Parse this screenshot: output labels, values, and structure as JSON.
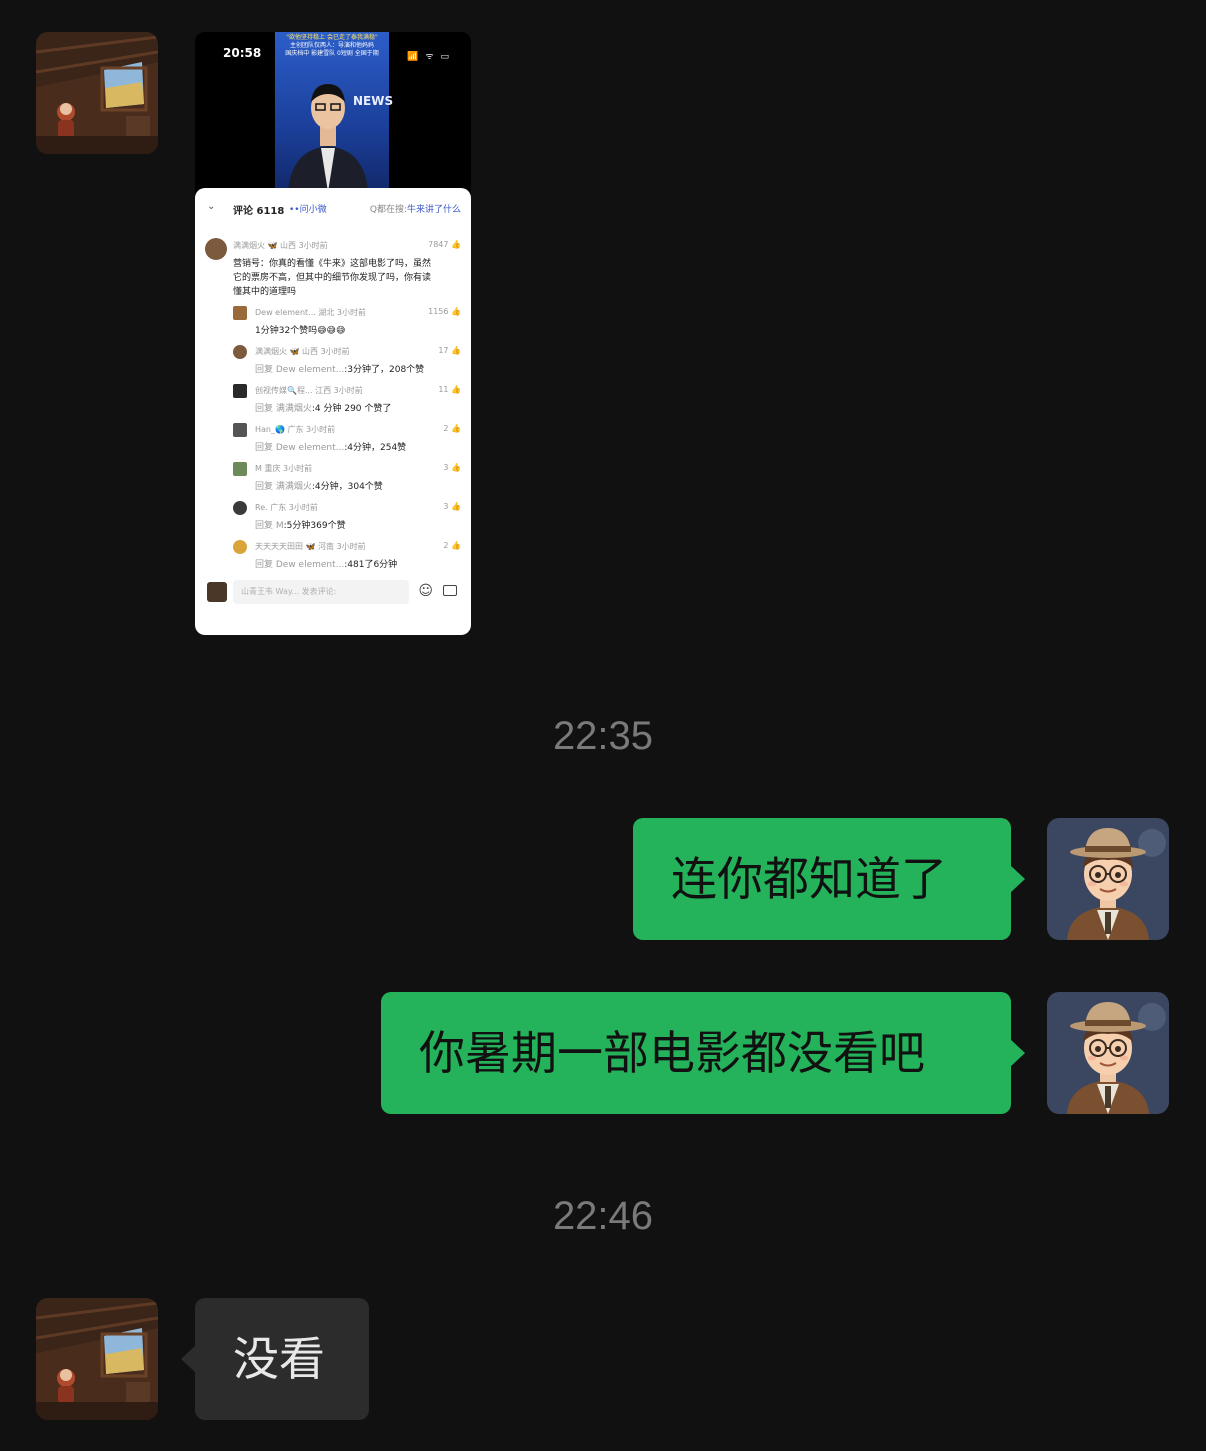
{
  "contact": {
    "avatar_icon": "attic-scene-avatar-icon"
  },
  "me": {
    "avatar_icon": "cartoon-man-hat-avatar-icon"
  },
  "screenshot_message": {
    "status_time": "20:58",
    "status_icons": "📶 ᯤ ▭",
    "video": {
      "headline_lines": [
        "\"欲他坚持稳上 会已走了泰我满稳\"",
        "主创团队仅两人：导演和他妈妈",
        "国庆档中 影建雪队 0短剧 全国于期"
      ],
      "news_label": "NEWS"
    },
    "comments_header": {
      "count": "评论 6118",
      "ask": "••问小微",
      "search_prefix": "Q都在搜:",
      "search_term": "牛来讲了什么"
    },
    "top_comment": {
      "meta": "满满烟火 🦋 山西 3小时前",
      "likes": "7847 👍",
      "lines": [
        "营销号：你真的看懂《牛来》这部电影了吗，虽然",
        "它的票房不高，但其中的细节你发现了吗，你有读",
        "懂其中的道理吗"
      ]
    },
    "replies": [
      {
        "meta": "Dew element... 湖北 3小时前",
        "likes": "1156 👍",
        "prefix": "",
        "text": "1分钟32个赞吗😅😅😅"
      },
      {
        "meta": "满满烟火 🦋 山西 3小时前",
        "likes": "17 👍",
        "prefix": "回复 Dew element...",
        "text": ":3分钟了，208个赞"
      },
      {
        "meta": "创视传媒🔍程... 江西 3小时前",
        "likes": "11 👍",
        "prefix": "回复 满满烟火",
        "text": ":4 分钟 290 个赞了"
      },
      {
        "meta": "Han_🌎 广东 3小时前",
        "likes": "2 👍",
        "prefix": "回复 Dew element...",
        "text": ":4分钟，254赞"
      },
      {
        "meta": "M 重庆 3小时前",
        "likes": "3 👍",
        "prefix": "回复 满满烟火",
        "text": ":4分钟，304个赞"
      },
      {
        "meta": "Re. 广东 3小时前",
        "likes": "3 👍",
        "prefix": "回复 M",
        "text": ":5分钟369个赞"
      },
      {
        "meta": "天天天天田田 🦋 河南 3小时前",
        "likes": "2 👍",
        "prefix": "回复 Dew element...",
        "text": ":481了6分钟"
      }
    ],
    "composer": {
      "placeholder": "山青王韦 Way... 发表评论:",
      "emoji_icon": "☺"
    }
  },
  "timestamps": [
    "22:35",
    "22:46"
  ],
  "messages": [
    {
      "side": "right",
      "text": "连你都知道了"
    },
    {
      "side": "right",
      "text": "你暑期一部电影都没看吧"
    },
    {
      "side": "left",
      "text": "没看"
    }
  ],
  "colors": {
    "background": "#111111",
    "green_bubble": "#24b35b",
    "grey_bubble": "#2c2c2c",
    "timestamp": "#7a7a7a"
  }
}
